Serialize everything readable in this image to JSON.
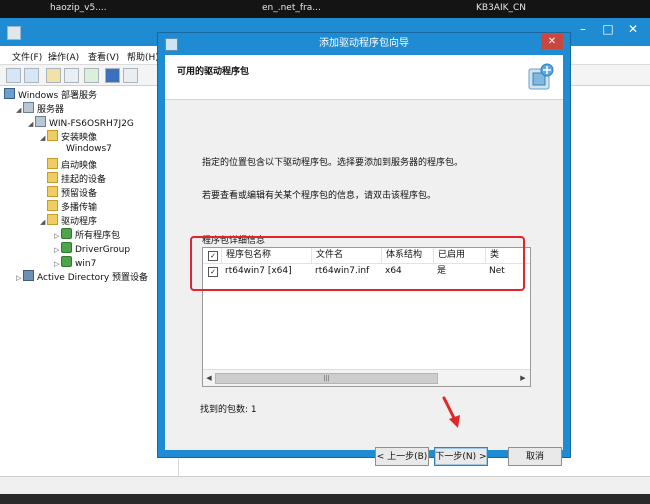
{
  "taskbar": {
    "items": [
      "haozip_v5....",
      "en_.net_fra...",
      "KB3AIK_CN"
    ]
  },
  "mmc": {
    "menu": [
      "文件(F)",
      "操作(A)",
      "查看(V)",
      "帮助(H)"
    ],
    "tree": {
      "root": "Windows 部署服务",
      "servers": "服务器",
      "server_name": "WIN-FS6OSRH7J2G",
      "install_images": "安装映像",
      "windows7": "Windows7",
      "boot_images": "启动映像",
      "pending_devices": "挂起的设备",
      "prestaged_devices": "预留设备",
      "multicast": "多播传输",
      "drivers": "驱动程序",
      "all_packages": "所有程序包",
      "driver_group": "DriverGroup",
      "win7": "win7",
      "active_directory": "Active Directory 预置设备"
    }
  },
  "wizard": {
    "title": "添加驱动程序包向导",
    "close_glyph": "✕",
    "heading": "可用的驱动程序包",
    "desc1": "指定的位置包含以下驱动程序包。选择要添加到服务器的程序包。",
    "desc2": "若要查看或编辑有关某个程序包的信息，请双击该程序包。",
    "details_label": "程序包详细信息",
    "columns": [
      "程序包名称",
      "文件名",
      "体系结构",
      "已启用",
      "类"
    ],
    "rows": [
      {
        "checked": true,
        "name": "rt64win7 [x64]",
        "file": "rt64win7.inf",
        "arch": "x64",
        "enabled": "是",
        "class": "Net"
      }
    ],
    "found_count": "找到的包数: 1",
    "buttons": {
      "back": "< 上一步(B)",
      "next": "下一步(N) >",
      "cancel": "取消"
    }
  },
  "colors": {
    "titlebar": "#1f8bd2",
    "highlight": "#e0262a"
  }
}
